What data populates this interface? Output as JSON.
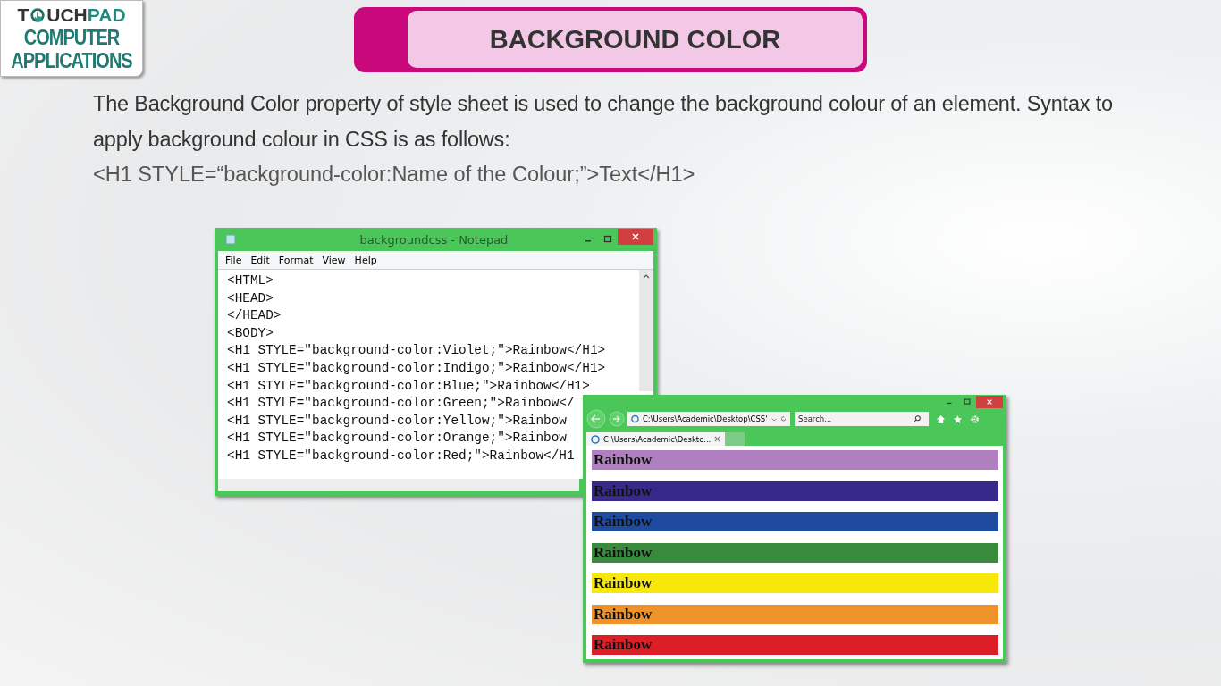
{
  "logo": {
    "brand_start": "T",
    "brand_middle": "UCH",
    "brand_end": "PAD",
    "line_1": "COMPUTER",
    "line_2": "APPLICATIONS"
  },
  "title": "BACKGROUND COLOR",
  "paragraph": "The Background Color property of style sheet is used to change the background colour of an element. Syntax to apply background colour in CSS is as follows:",
  "syntax": "<H1 STYLE=“background-color:Name of the Colour;”>Text</H1>",
  "notepad": {
    "title": "backgroundcss - Notepad",
    "menu": [
      "File",
      "Edit",
      "Format",
      "View",
      "Help"
    ],
    "lines": [
      "<HTML>",
      "<HEAD>",
      "</HEAD>",
      "<BODY>",
      "<H1 STYLE=\"background-color:Violet;\">Rainbow</H1>",
      "<H1 STYLE=\"background-color:Indigo;\">Rainbow</H1>",
      "<H1 STYLE=\"background-color:Blue;\">Rainbow</H1>",
      "<H1 STYLE=\"background-color:Green;\">Rainbow</",
      "<H1 STYLE=\"background-color:Yellow;\">Rainbow",
      "<H1 STYLE=\"background-color:Orange;\">Rainbow",
      "<H1 STYLE=\"background-color:Red;\">Rainbow</H1"
    ]
  },
  "browser": {
    "address": "C:\\Users\\Academic\\Desktop\\CSS'",
    "search_placeholder": "Search...",
    "tab": {
      "label": "C:\\Users\\Academic\\Deskto...",
      "selected": true
    },
    "headings": [
      {
        "text": "Rainbow",
        "color": "#b07fc0"
      },
      {
        "text": "Rainbow",
        "color": "#35298a"
      },
      {
        "text": "Rainbow",
        "color": "#1e4aa0"
      },
      {
        "text": "Rainbow",
        "color": "#3a8a3e"
      },
      {
        "text": "Rainbow",
        "color": "#f8e80a"
      },
      {
        "text": "Rainbow",
        "color": "#f0922a"
      },
      {
        "text": "Rainbow",
        "color": "#dc1f26"
      }
    ]
  }
}
